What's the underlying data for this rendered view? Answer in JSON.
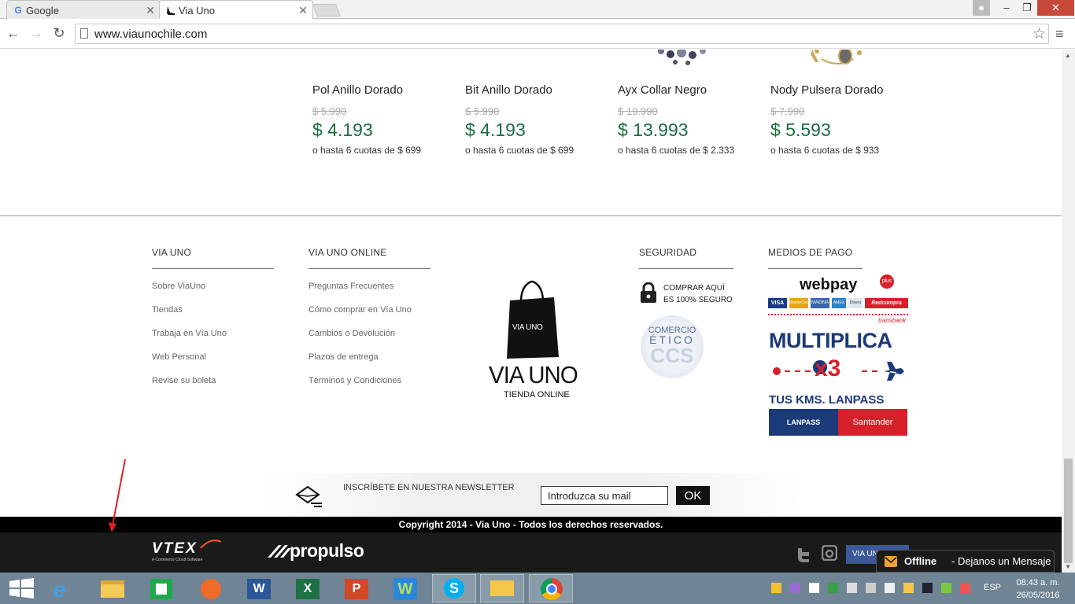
{
  "browser": {
    "tabs": [
      {
        "title": "Google",
        "icon": "google-icon",
        "active": false
      },
      {
        "title": "Via Uno",
        "icon": "shoe-icon",
        "active": true
      }
    ],
    "url": "www.viaunochile.com"
  },
  "products": [
    {
      "name": "Pol Anillo Dorado",
      "old_price": "$ 5.990",
      "price": "$ 4.193",
      "installments": "o hasta 6 cuotas de $ 699"
    },
    {
      "name": "Bit Anillo Dorado",
      "old_price": "$ 5.990",
      "price": "$ 4.193",
      "installments": "o hasta 6 cuotas de $ 699"
    },
    {
      "name": "Ayx Collar Negro",
      "old_price": "$ 19.990",
      "price": "$ 13.993",
      "installments": "o hasta 6 cuotas de $ 2.333"
    },
    {
      "name": "Nody Pulsera Dorado",
      "old_price": "$ 7.990",
      "price": "$ 5.593",
      "installments": "o hasta 6 cuotas de $ 933"
    }
  ],
  "footer": {
    "via_uno": {
      "heading": "VIA UNO",
      "links": [
        "Sobre ViaUno",
        "Tiendas",
        "Trabaja en Vía Uno",
        "Web Personal",
        "Revise su boleta"
      ]
    },
    "online": {
      "heading": "VIA UNO ONLINE",
      "links": [
        "Preguntas Frecuentes",
        "Cómo comprar en Vía Uno",
        "Cambios o Devolución",
        "Plazos de entrega",
        "Términos y Condiciones"
      ]
    },
    "logo": {
      "bag_text": "VIA UNO",
      "brand": "VIA UNO",
      "tagline": "TIENDA ONLINE"
    },
    "security": {
      "heading": "SEGURIDAD",
      "secure_line1": "COMPRAR AQUÍ",
      "secure_line2": "ES 100% SEGURO",
      "seal_line1": "COMERCIO",
      "seal_line2": "ÉTICO",
      "seal_line3": "CCS"
    },
    "payment": {
      "heading": "MEDIOS DE PAGO",
      "webpay": "webpay",
      "webpay_plus": "plus",
      "cards": [
        "VISA",
        "MasterCard",
        "MAGNA",
        "AMEX",
        "Diners",
        "Redcompra"
      ],
      "transbank": "transbank",
      "promo_title": "MULTIPLICA",
      "promo_mult": "x3",
      "promo_line": "TUS KMS. LANPASS",
      "lanpass": "LANPASS",
      "santander": "Santander"
    },
    "newsletter": {
      "label": "INSCRÍBETE EN NUESTRA NEWSLETTER",
      "placeholder": "Introduzca su mail",
      "button": "OK"
    },
    "copyright": "Copyright 2014 - Via Uno - Todos los derechos reservados.",
    "partners": {
      "vtex": "VTEX",
      "vtex_sub": "e-Commerce Cloud Software",
      "propulso": "propulso"
    },
    "social_button": "VIA UNO"
  },
  "chat": {
    "status": "Offline",
    "message": "- Dejanos un Mensaje"
  },
  "taskbar": {
    "apps": [
      "windows-start",
      "internet-explorer",
      "file-explorer",
      "windows-store",
      "origin",
      "word",
      "excel",
      "powerpoint",
      "wunderlist",
      "skype",
      "outlook",
      "chrome"
    ],
    "language": "ESP",
    "time": "08:43 a. m.",
    "date": "26/05/2016"
  },
  "colors": {
    "price_green": "#1c6c41",
    "lanpass_blue": "#1b3a7a",
    "santander_red": "#d7202a",
    "webpay_red": "#d7202a"
  }
}
